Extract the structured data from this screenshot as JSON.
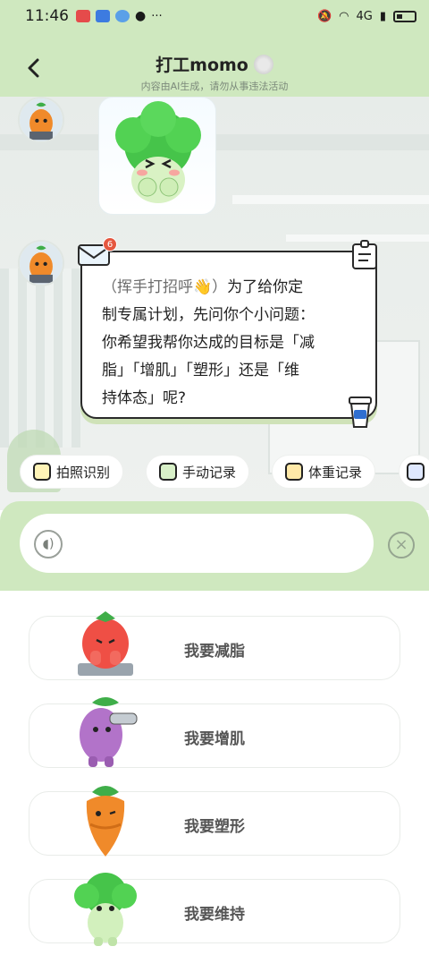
{
  "status_bar": {
    "time": "11:46",
    "network": "4G"
  },
  "header": {
    "back_icon": "chevron-left-icon",
    "title": "打工momo",
    "subtitle": "内容由AI生成，请勿从事违法活动"
  },
  "chat": {
    "message": {
      "line1_muted": "（挥手打招呼👋）",
      "line1_rest": "为了给你定",
      "line2": "制专属计划，先问你个小问题：",
      "line3": "你希望我帮你达成的目标是「减",
      "line4": "脂」「增肌」「塑形」还是「维",
      "line5": "持体态」呢?"
    },
    "badge_count": "6"
  },
  "quick_actions": [
    {
      "label": "拍照识别",
      "icon": "camera-icon"
    },
    {
      "label": "手动记录",
      "icon": "pen-icon"
    },
    {
      "label": "体重记录",
      "icon": "scale-icon"
    }
  ],
  "input": {
    "placeholder": "",
    "voice_icon": "voice-icon",
    "clear_icon": "close-circle-icon"
  },
  "options": [
    {
      "label": "我要减脂",
      "mascot": "tomato-mascot"
    },
    {
      "label": "我要增肌",
      "mascot": "eggplant-mascot"
    },
    {
      "label": "我要塑形",
      "mascot": "carrot-mascot"
    },
    {
      "label": "我要维持",
      "mascot": "broccoli-mascot"
    }
  ],
  "colors": {
    "accent_green": "#cfe8bf",
    "bubble_shadow": "#cfe2b8"
  }
}
